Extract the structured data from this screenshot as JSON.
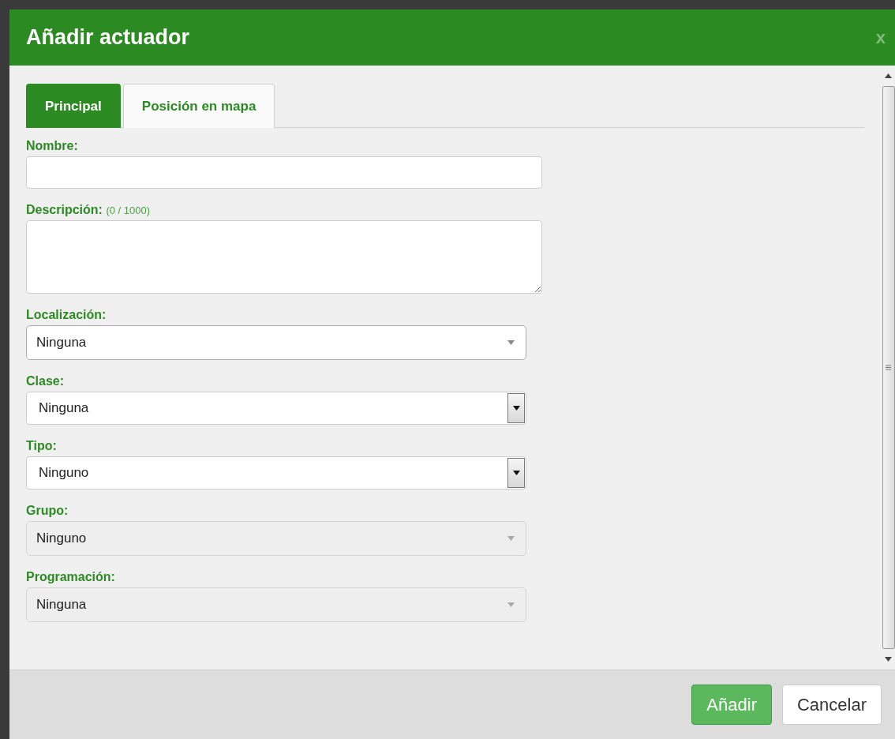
{
  "dialog": {
    "title": "Añadir actuador",
    "close": "x"
  },
  "tabs": [
    {
      "label": "Principal",
      "selected": true
    },
    {
      "label": "Posición en mapa",
      "selected": false
    }
  ],
  "fields": [
    {
      "kind": "text",
      "label": "Nombre:"
    },
    {
      "kind": "textarea",
      "label": "Descripción:",
      "counter": "(0 / 1000)"
    },
    {
      "kind": "combo",
      "label": "Localización:",
      "value": "Ninguna",
      "disabled": false
    },
    {
      "kind": "select",
      "label": "Clase:",
      "value": "Ninguna",
      "disabled": false
    },
    {
      "kind": "select",
      "label": "Tipo:",
      "value": "Ninguno",
      "disabled": false
    },
    {
      "kind": "combo",
      "label": "Grupo:",
      "value": "Ninguno",
      "disabled": true
    },
    {
      "kind": "combo",
      "label": "Programación:",
      "value": "Ninguna",
      "disabled": true
    }
  ],
  "buttons": [
    {
      "label": "Añadir",
      "kind": "primary"
    },
    {
      "label": "Cancelar",
      "kind": "default"
    }
  ]
}
